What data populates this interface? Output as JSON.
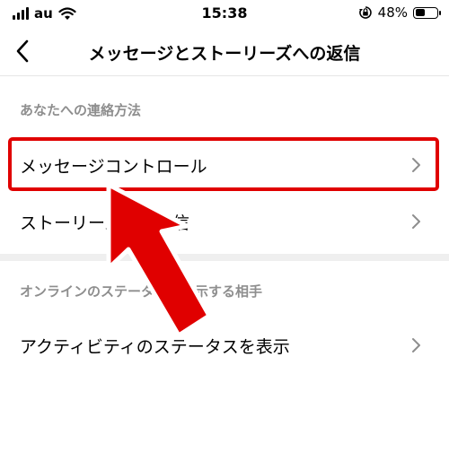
{
  "status_bar": {
    "carrier": "au",
    "time": "15:38",
    "battery_percent": "48%",
    "battery_level": 0.48,
    "icons": [
      "signal-bars-icon",
      "wifi-icon",
      "orientation-lock-icon",
      "battery-icon"
    ]
  },
  "nav": {
    "title": "メッセージとストーリーズへの返信",
    "back_icon": "chevron-left-icon"
  },
  "sections": [
    {
      "header": "あなたへの連絡方法",
      "items": [
        {
          "label": "メッセージコントロール",
          "icon": "chevron-right-icon"
        },
        {
          "label": "ストーリーズへの返信",
          "icon": "chevron-right-icon"
        }
      ]
    },
    {
      "header": "オンラインのステータスを表示する相手",
      "items": [
        {
          "label": "アクティビティのステータスを表示",
          "icon": "chevron-right-icon"
        }
      ]
    }
  ],
  "annotation": {
    "highlight_color": "#e00000",
    "arrow_color": "#e00000"
  }
}
